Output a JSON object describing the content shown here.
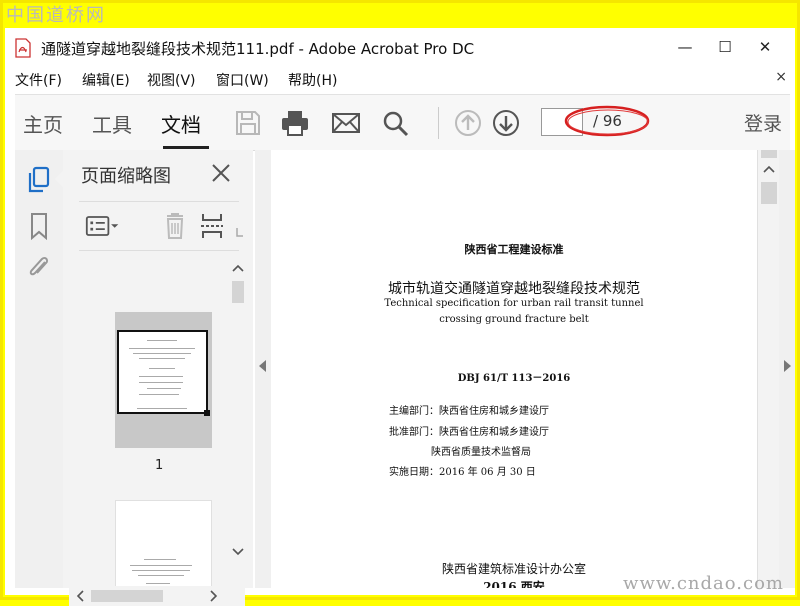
{
  "watermark": {
    "top": "中国道桥网",
    "bottom": "www.cndao.com"
  },
  "window": {
    "title": "通隧道穿越地裂缝段技术规范111.pdf - Adobe Acrobat Pro DC",
    "controls": {
      "minimize": "—",
      "maximize": "☐",
      "close": "✕"
    }
  },
  "menu": {
    "items": [
      "文件(F)",
      "编辑(E)",
      "视图(V)",
      "窗口(W)",
      "帮助(H)"
    ],
    "close": "×"
  },
  "toolbar": {
    "tabs": [
      "主页",
      "工具",
      "文档"
    ],
    "active_tab": "文档",
    "page_current": "",
    "page_total": "/ 96",
    "login": "登录"
  },
  "thumbnails": {
    "title": "页面缩略图",
    "page1_label": "1"
  },
  "document": {
    "header": "陕西省工程建设标准",
    "title_cn": "城市轨道交通隧道穿越地裂缝段技术规范",
    "title_en_1": "Technical specification for urban rail transit tunnel",
    "title_en_2": "crossing ground fracture belt",
    "code": "DBJ 61/T 113－2016",
    "dept": "主编部门：陕西省住房和城乡建设厅",
    "approve": "批准部门：陕西省住房和城乡建设厅",
    "approve2": "陕西省质量技术监督局",
    "date": "实施日期：2016 年 06 月 30 日",
    "publisher": "陕西省建筑标准设计办公室",
    "year_place": "2016 西安"
  },
  "colors": {
    "accent_ellipse": "#d62020",
    "rail_icon": "#1f6fc7"
  }
}
